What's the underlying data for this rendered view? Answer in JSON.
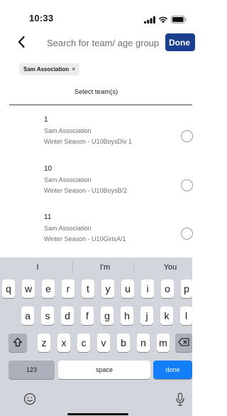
{
  "status_bar": {
    "time": "10:33"
  },
  "header": {
    "search_placeholder": "Search for team/ age group",
    "done_label": "Done"
  },
  "filter_chip": {
    "label": "Sam Association",
    "close_glyph": "×"
  },
  "section_title": "Select team(s)",
  "teams": [
    {
      "number": "1",
      "association": "Sam Association",
      "season": "Winter Season - U10BoysDiv 1"
    },
    {
      "number": "10",
      "association": "Sam Association",
      "season": "Winter Season - U10BoysB/2"
    },
    {
      "number": "11",
      "association": "Sam Association",
      "season": "Winter Season - U10GirlsA/1"
    }
  ],
  "keyboard": {
    "suggestions": [
      "I",
      "I'm",
      "You"
    ],
    "row1": [
      "q",
      "w",
      "e",
      "r",
      "t",
      "y",
      "u",
      "i",
      "o",
      "p"
    ],
    "row2": [
      "a",
      "s",
      "d",
      "f",
      "g",
      "h",
      "j",
      "k",
      "l"
    ],
    "row3": [
      "z",
      "x",
      "c",
      "v",
      "b",
      "n",
      "m"
    ],
    "numbers_label": "123",
    "space_label": "space",
    "done_label": "done"
  },
  "icons": {
    "back": "chevron-left-icon",
    "signal": "signal-bars-icon",
    "wifi": "wifi-icon",
    "battery": "battery-icon",
    "shift": "shift-icon",
    "delete": "backspace-icon",
    "emoji": "emoji-icon",
    "mic": "microphone-icon"
  },
  "colors": {
    "done_button": "#1a3f8f",
    "keyboard_done": "#147efb",
    "keyboard_bg": "#d3d5dc"
  }
}
